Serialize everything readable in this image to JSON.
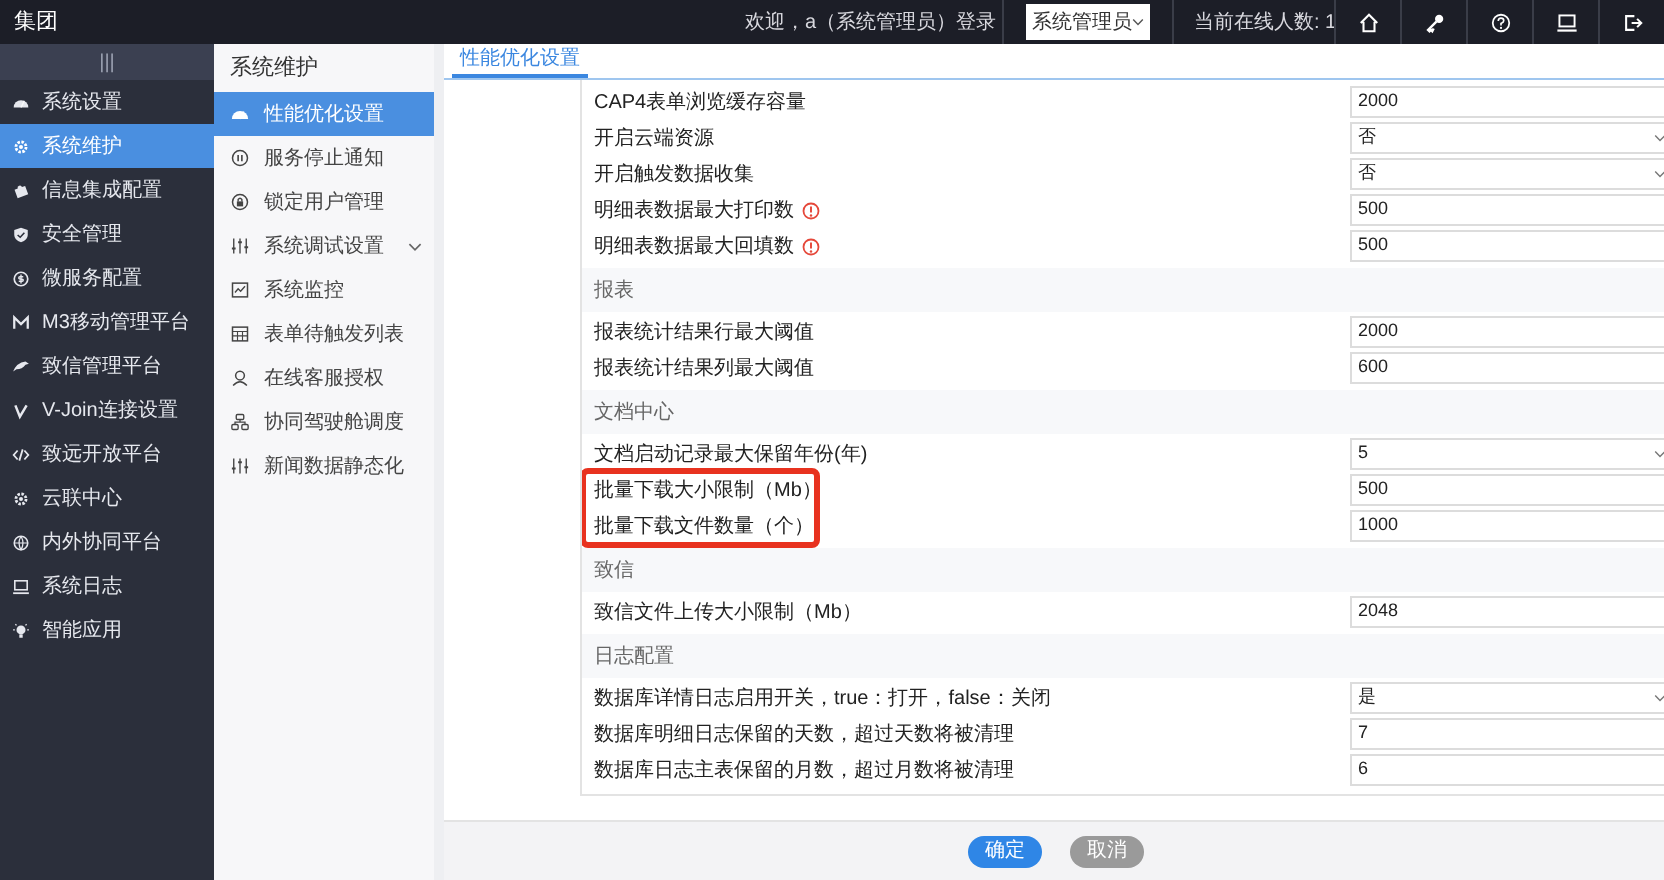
{
  "topbar": {
    "brand": "集团",
    "welcome": "欢迎，a（系统管理员）登录",
    "role_select": "系统管理员",
    "online": "当前在线人数: 1",
    "icons": [
      {
        "kind": "home"
      },
      {
        "kind": "key"
      },
      {
        "kind": "help"
      },
      {
        "kind": "monitor"
      },
      {
        "kind": "logout"
      }
    ]
  },
  "sidebar": {
    "toggle": "|||",
    "items": [
      {
        "label": "系统设置",
        "selected": false
      },
      {
        "label": "系统维护",
        "selected": true
      },
      {
        "label": "信息集成配置",
        "selected": false
      },
      {
        "label": "安全管理",
        "selected": false
      },
      {
        "label": "微服务配置",
        "selected": false
      },
      {
        "label": "M3移动管理平台",
        "selected": false
      },
      {
        "label": "致信管理平台",
        "selected": false
      },
      {
        "label": "V-Join连接设置",
        "selected": false
      },
      {
        "label": "致远开放平台",
        "selected": false
      },
      {
        "label": "云联中心",
        "selected": false
      },
      {
        "label": "内外协同平台",
        "selected": false
      },
      {
        "label": "系统日志",
        "selected": false
      },
      {
        "label": "智能应用",
        "selected": false
      }
    ]
  },
  "subnav": {
    "title": "系统维护",
    "items": [
      {
        "label": "性能优化设置",
        "selected": true
      },
      {
        "label": "服务停止通知",
        "selected": false
      },
      {
        "label": "锁定用户管理",
        "selected": false
      },
      {
        "label": "系统调试设置",
        "selected": false,
        "expanded": false
      },
      {
        "label": "系统监控",
        "selected": false
      },
      {
        "label": "表单待触发列表",
        "selected": false
      },
      {
        "label": "在线客服授权",
        "selected": false
      },
      {
        "label": "协同驾驶舱调度",
        "selected": false
      },
      {
        "label": "新闻数据静态化",
        "selected": false
      }
    ]
  },
  "tabs": [
    {
      "label": "性能优化设置",
      "selected": true
    }
  ],
  "sections": [
    {
      "rows": [
        {
          "label": "CAP4表单浏览缓存容量",
          "kind": "input",
          "value": "2000",
          "warning": false,
          "highlighted": false
        },
        {
          "label": "开启云端资源",
          "kind": "select",
          "value": "否",
          "warning": false,
          "highlighted": false
        },
        {
          "label": "开启触发数据收集",
          "kind": "select",
          "value": "否",
          "warning": false,
          "highlighted": false
        },
        {
          "label": "明细表数据最大打印数",
          "kind": "input",
          "value": "500",
          "warning": true,
          "highlighted": false
        },
        {
          "label": "明细表数据最大回填数",
          "kind": "input",
          "value": "500",
          "warning": true,
          "highlighted": false
        }
      ]
    },
    {
      "title": "报表",
      "rows": [
        {
          "label": "报表统计结果行最大阈值",
          "kind": "input",
          "value": "2000",
          "warning": false,
          "highlighted": false
        },
        {
          "label": "报表统计结果列最大阈值",
          "kind": "input",
          "value": "600",
          "warning": false,
          "highlighted": false
        }
      ]
    },
    {
      "title": "文档中心",
      "rows": [
        {
          "label": "文档启动记录最大保留年份(年)",
          "kind": "select",
          "value": "5",
          "warning": false,
          "highlighted": false
        },
        {
          "label": "批量下载大小限制（Mb）",
          "kind": "input",
          "value": "500",
          "warning": false,
          "highlighted": true
        },
        {
          "label": "批量下载文件数量（个）",
          "kind": "input",
          "value": "1000",
          "warning": false,
          "highlighted": true
        }
      ]
    },
    {
      "title": "致信",
      "rows": [
        {
          "label": "致信文件上传大小限制（Mb）",
          "kind": "input",
          "value": "2048",
          "warning": false,
          "highlighted": false
        }
      ]
    },
    {
      "title": "日志配置",
      "rows": [
        {
          "label": "数据库详情日志启用开关，true：打开，false：关闭",
          "kind": "select",
          "value": "是",
          "warning": false,
          "highlighted": false
        },
        {
          "label": "数据库明细日志保留的天数，超过天数将被清理",
          "kind": "input",
          "value": "7",
          "warning": false,
          "highlighted": false
        },
        {
          "label": "数据库日志主表保留的月数，超过月数将被清理",
          "kind": "input",
          "value": "6",
          "warning": false,
          "highlighted": false
        }
      ]
    }
  ],
  "buttons": [
    {
      "label": "确定",
      "kind": "primary"
    },
    {
      "label": "取消",
      "kind": "secondary"
    }
  ]
}
